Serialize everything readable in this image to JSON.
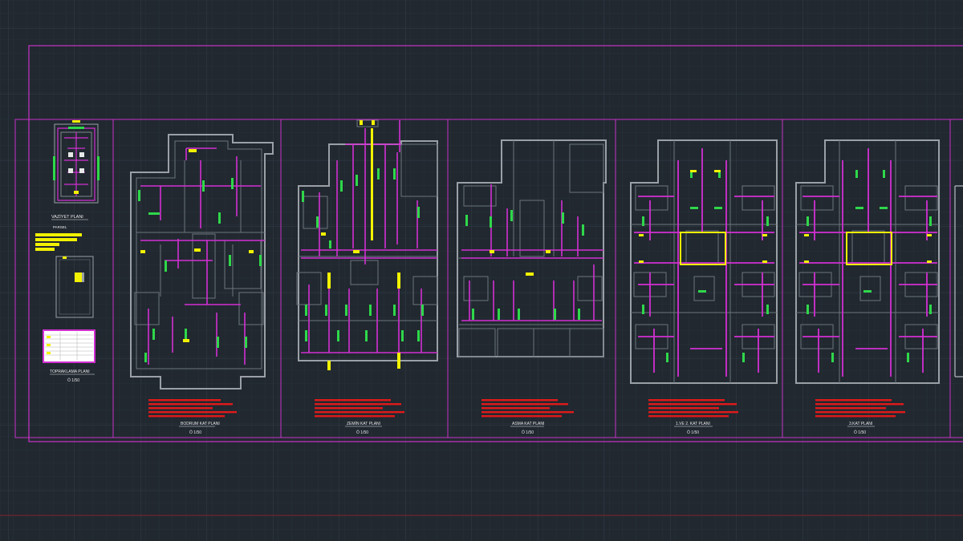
{
  "drawing": {
    "colors": {
      "background": "#212830",
      "grid_minor": "#2a323b",
      "grid_major": "#313a44",
      "sheet_border": "#c832c8",
      "walls": "#9aa0a6",
      "circuits": "#d22fd2",
      "fixtures_green": "#2fd84a",
      "fixtures_yellow": "#f2f200",
      "annotation_red": "#e01a1a",
      "axis_red": "#8a2323"
    },
    "panels": [
      {
        "id": "site",
        "title": "VAZİYET PLANI",
        "subtitle": "PARSEL",
        "title2": "TOPRAKLAMA PLANI",
        "scale": "Ö 1/50"
      },
      {
        "id": "bodrum",
        "title": "BODRUM KAT PLANI",
        "scale": "Ö 1/50"
      },
      {
        "id": "zemin",
        "title": "ZEMİN KAT PLANI",
        "scale": "Ö 1/50"
      },
      {
        "id": "asma",
        "title": "ASMA KAT PLANI",
        "scale": "Ö 1/50"
      },
      {
        "id": "normal12",
        "title": "1.VE 2. KAT PLANI",
        "scale": "Ö 1/50"
      },
      {
        "id": "normal3",
        "title": "3.KAT PLANI",
        "scale": "Ö 1/50"
      }
    ]
  }
}
